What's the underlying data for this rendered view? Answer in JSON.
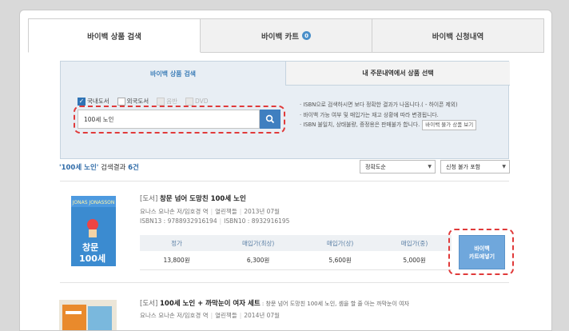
{
  "tabs": [
    {
      "label": "바이백 상품 검색"
    },
    {
      "label": "바이백 카트",
      "badge": "0"
    },
    {
      "label": "바이백 신청내역"
    }
  ],
  "search": {
    "subtabs": [
      "바이백 상품 검색",
      "내 주문내역에서 상품 선택"
    ],
    "categories": [
      {
        "label": "국내도서",
        "checked": true
      },
      {
        "label": "외국도서",
        "checked": false
      },
      {
        "label": "음반",
        "checked": false
      },
      {
        "label": "DVD",
        "checked": false
      }
    ],
    "query": "100세 노인",
    "notes": [
      "· ISBN으로 검색하시면 보다 정확한 결과가 나옵니다.( - 하이픈 제외)",
      "· 바이백 가능 여부 및 매입가는 재고 상황에 따라 변경됩니다.",
      "· ISBN 불일치, 상태불량, 증정용은 판매불가 합니다."
    ],
    "unsellable_button": "바이백 불가 상품 보기"
  },
  "results": {
    "keyword": "'100세 노인'",
    "text": " 검색결과 ",
    "count": "6건",
    "sort": "정확도순",
    "filter": "신청 불가 포함"
  },
  "books": [
    {
      "type": "[도서]",
      "title": "창문 넘어 도망친 100세 노인",
      "authors": "요나스 요나손 저/임호경 역",
      "publisher": "열린책들",
      "date": "2013년 07월",
      "isbn13": "ISBN13 : 9788932916194",
      "isbn10": "ISBN10 : 8932916195",
      "price_headers": [
        "정가",
        "매입가(최상)",
        "매입가(상)",
        "매입가(중)"
      ],
      "prices": [
        "13,800원",
        "6,300원",
        "5,600원",
        "5,000원"
      ],
      "button_line1": "바이백",
      "button_line2": "카트에넣기"
    },
    {
      "type": "[도서]",
      "title": "100세 노인 + 까막눈이 여자 세트",
      "desc": " : 창문 넘어 도망친 100세 노인, 셈을 할 줄 아는 까막눈이 여자",
      "authors": "요나스 요나손 저/임호경 역",
      "publisher": "열린책들",
      "date": "2014년 07월"
    }
  ],
  "colors": {
    "accent": "#3f7fc0",
    "highlight": "#e03a3a"
  }
}
